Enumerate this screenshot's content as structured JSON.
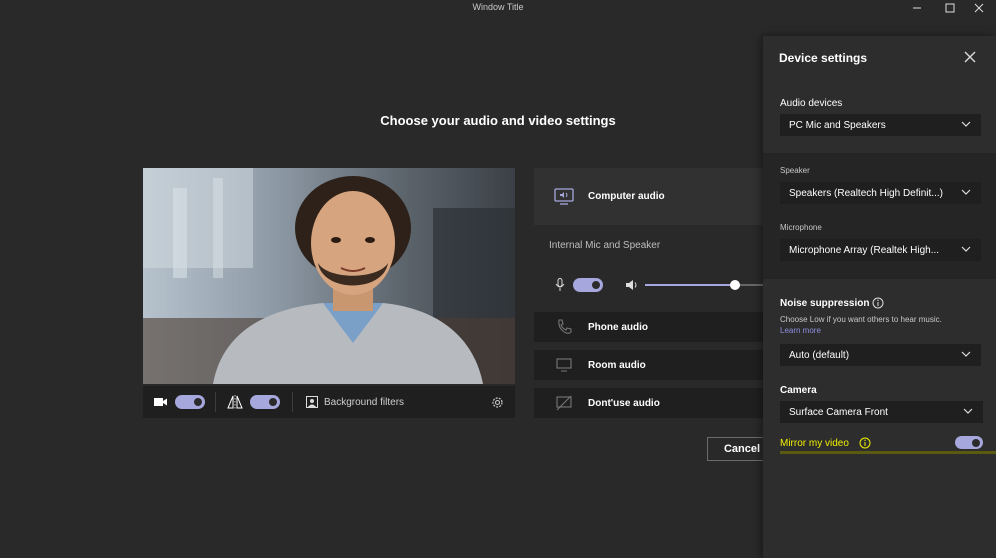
{
  "window": {
    "title": "Window Title"
  },
  "main": {
    "heading": "Choose your audio and video settings",
    "video_toolbar": {
      "background_filters_label": "Background filters"
    },
    "audio_options": [
      {
        "label": "Computer audio",
        "icon": "computer-audio-icon",
        "selected": true
      },
      {
        "label": "Phone audio",
        "icon": "phone-icon"
      },
      {
        "label": "Room audio",
        "icon": "room-audio-icon"
      },
      {
        "label": "Dont'use audio",
        "icon": "no-audio-icon"
      }
    ],
    "computer_audio_device": "Internal Mic and Speaker",
    "volume_level": 0.76,
    "cancel_label": "Cancel"
  },
  "device_settings": {
    "title": "Device settings",
    "audio_devices_label": "Audio devices",
    "audio_devices_value": "PC Mic and Speakers",
    "speaker_label": "Speaker",
    "speaker_value": "Speakers (Realtech High Definit...)",
    "microphone_label": "Microphone",
    "microphone_value": "Microphone Array (Realtek High...",
    "noise_suppression_label": "Noise suppression",
    "noise_suppression_desc": "Choose Low if you want others to hear music.",
    "learn_more": "Learn more",
    "noise_suppression_value": "Auto (default)",
    "camera_label": "Camera",
    "camera_value": "Surface Camera Front",
    "mirror_label": "Mirror my video",
    "mirror_on": true
  },
  "colors": {
    "accent": "#a6a7dc",
    "highlight_text": "#f3f000",
    "link": "#8f8fe0"
  }
}
